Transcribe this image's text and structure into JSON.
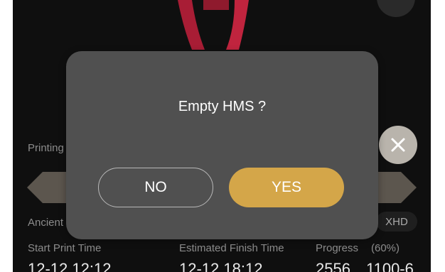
{
  "background": {
    "printing_label": "Printing",
    "ancient_label": "Ancient",
    "xhd_chip": "XHD",
    "start_print_time_label": "Start Print Time",
    "estimated_finish_time_label": "Estimated Finish Time",
    "progress_label": "Progress",
    "progress_percent": "(60%)",
    "start_print_time_value": "12-12 12:12",
    "estimated_finish_time_value": "12-12 18:12",
    "progress_value": "2556",
    "progress_extra": "1100-6"
  },
  "dialog": {
    "title": "Empty HMS ?",
    "no_label": "NO",
    "yes_label": "YES"
  },
  "icons": {
    "close": "close-icon"
  },
  "colors": {
    "accent": "#d4a649",
    "dialog_bg": "#505050",
    "model_red": "#b5213a"
  }
}
